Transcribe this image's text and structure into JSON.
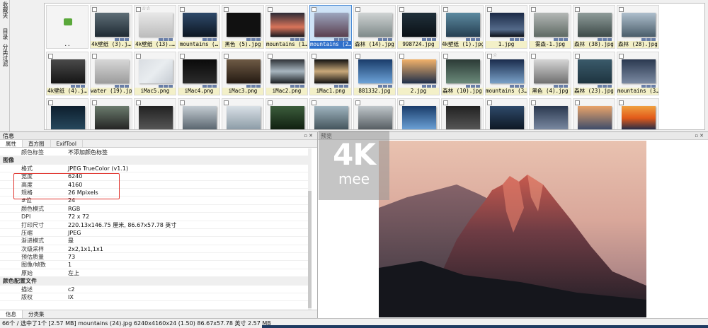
{
  "left_tabs": [
    "收藏夹",
    "目录",
    "分类过滤"
  ],
  "grid": {
    "rows": [
      [
        {
          "caption": "..",
          "thumb": "t0",
          "folder": true
        },
        {
          "caption": "4k壁纸 (3).j…",
          "thumb": "t1"
        },
        {
          "caption": "4k壁纸 (13).…",
          "thumb": "t2",
          "stars": "☆☆"
        },
        {
          "caption": "mountains (…",
          "thumb": "t3"
        },
        {
          "caption": "黑色 (5).jpg",
          "thumb": "t4"
        },
        {
          "caption": "mountains (1…",
          "thumb": "t5"
        },
        {
          "caption": "mountains (2…",
          "thumb": "t6",
          "selected": true
        },
        {
          "caption": "森林 (14).jpg",
          "thumb": "t7"
        },
        {
          "caption": "998724.jpg",
          "thumb": "t8"
        },
        {
          "caption": "4k壁纸 (1).jpg",
          "thumb": "t9"
        },
        {
          "caption": "1.jpg",
          "thumb": "t10"
        },
        {
          "caption": "雾森-1.jpg",
          "thumb": "t11"
        },
        {
          "caption": "森林 (38).jpg",
          "thumb": "t12"
        },
        {
          "caption": "森林 (28).jpg",
          "thumb": "t13"
        }
      ],
      [
        {
          "caption": "4k壁纸 (4).j…",
          "thumb": "t14"
        },
        {
          "caption": "water (19).jpg",
          "thumb": "t15"
        },
        {
          "caption": "iMac5.png",
          "thumb": "t16"
        },
        {
          "caption": "iMac4.png",
          "thumb": "t17"
        },
        {
          "caption": "iMac3.png",
          "thumb": "t18"
        },
        {
          "caption": "iMac2.png",
          "thumb": "t19"
        },
        {
          "caption": "iMac1.png",
          "thumb": "t20"
        },
        {
          "caption": "881332.jpg",
          "thumb": "t21"
        },
        {
          "caption": "2.jpg",
          "thumb": "t22"
        },
        {
          "caption": "森林 (10).jpg",
          "thumb": "t23"
        },
        {
          "caption": "mountains (3…",
          "thumb": "t24",
          "stars": "☆"
        },
        {
          "caption": "黑色 (4).jpg",
          "thumb": "t25"
        },
        {
          "caption": "森林 (23).jpg",
          "thumb": "t26"
        },
        {
          "caption": "mountains (3…",
          "thumb": "t27"
        }
      ],
      [
        {
          "caption": "",
          "thumb": "t28"
        },
        {
          "caption": "",
          "thumb": "t29"
        },
        {
          "caption": "",
          "thumb": "t30"
        },
        {
          "caption": "",
          "thumb": "t31"
        },
        {
          "caption": "",
          "thumb": "t32"
        },
        {
          "caption": "",
          "thumb": "t33"
        },
        {
          "caption": "",
          "thumb": "t34"
        },
        {
          "caption": "",
          "thumb": "t35"
        },
        {
          "caption": "",
          "thumb": "t21"
        },
        {
          "caption": "",
          "thumb": "t30"
        },
        {
          "caption": "",
          "thumb": "t3"
        },
        {
          "caption": "",
          "thumb": "t27"
        },
        {
          "caption": "",
          "thumb": "t36"
        },
        {
          "caption": "",
          "thumb": "t37"
        }
      ]
    ]
  },
  "info_panel": {
    "title": "信息",
    "tabs": [
      "属性",
      "直方图",
      "ExifTool"
    ],
    "rows": [
      {
        "key": "颜色标签",
        "value": "不添加颜色标签"
      },
      {
        "section": "图像"
      },
      {
        "key": "格式",
        "value": "JPEG TrueColor (v1.1)"
      },
      {
        "key": "宽度",
        "value": "6240"
      },
      {
        "key": "高度",
        "value": "4160"
      },
      {
        "key": "规格",
        "value": "26 Mpixels"
      },
      {
        "key": "#位",
        "value": "24"
      },
      {
        "key": "颜色模式",
        "value": "RGB"
      },
      {
        "key": "DPI",
        "value": "72 x 72"
      },
      {
        "key": "打印尺寸",
        "value": "220.13x146.75 厘米, 86.67x57.78 英寸"
      },
      {
        "key": "压缩",
        "value": "JPEG"
      },
      {
        "key": "渐进模式",
        "value": "是"
      },
      {
        "key": "次级采样",
        "value": "2x2,1x1,1x1"
      },
      {
        "key": "预估质量",
        "value": "73"
      },
      {
        "key": "图像/帧数",
        "value": "1"
      },
      {
        "key": "原始",
        "value": "左上"
      },
      {
        "section": "颜色配置文件"
      },
      {
        "key": "描述",
        "value": "c2"
      },
      {
        "key": "版权",
        "value": "IX"
      }
    ],
    "bottom_tabs": [
      "信息",
      "分类集"
    ]
  },
  "preview_panel": {
    "title": "预览"
  },
  "watermark": {
    "line1": "4K",
    "line2": "mee"
  },
  "status_bar": "66个 / 选中了1个 [2.57 MB]  mountains (24).jpg  6240x4160x24 (1.50)  86.67x57.78 英寸  2.57 MB",
  "colors": {
    "selection": "#2f6fca",
    "highlight_box": "#e0312b",
    "caption_bg": "#f3f0c8"
  }
}
